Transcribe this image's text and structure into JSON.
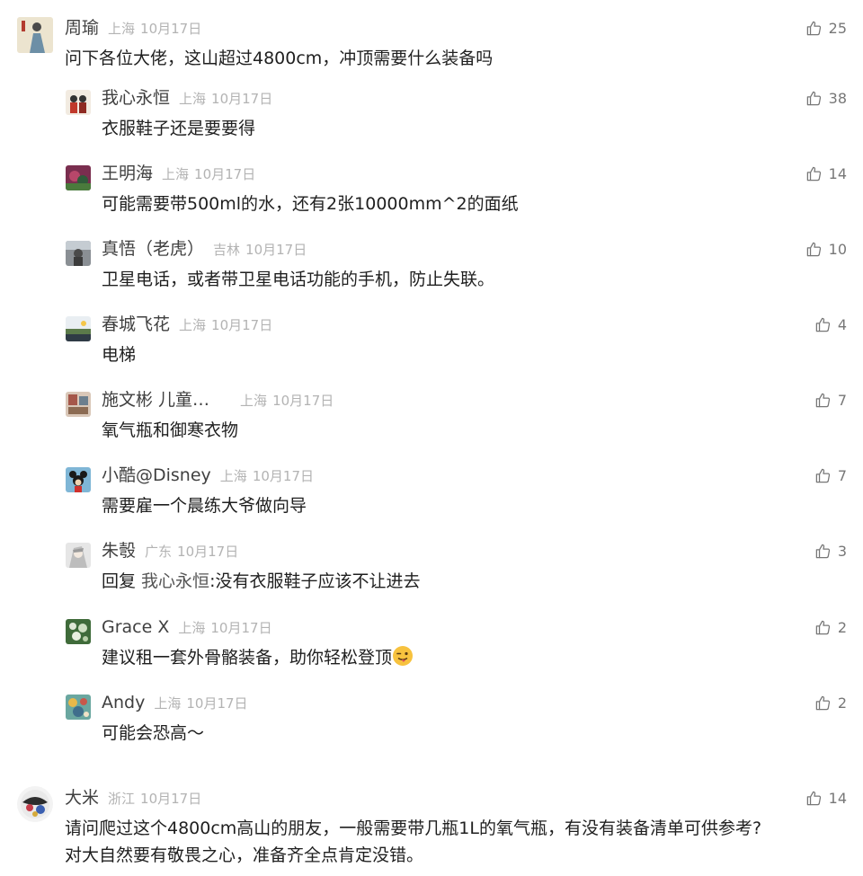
{
  "comments": [
    {
      "name": "周瑜",
      "location": "上海",
      "date": "10月17日",
      "likes": "25",
      "text": "问下各位大佬，这山超过4800cm，冲顶需要什么装备吗"
    },
    {
      "name": "我心永恒",
      "location": "上海",
      "date": "10月17日",
      "likes": "38",
      "text": "衣服鞋子还是要要得"
    },
    {
      "name": "王明海",
      "location": "上海",
      "date": "10月17日",
      "likes": "14",
      "text": "可能需要带500ml的水，还有2张10000mm^2的面纸"
    },
    {
      "name": "真悟（老虎）",
      "location": "吉林",
      "date": "10月17日",
      "likes": "10",
      "text": "卫星电话，或者带卫星电话功能的手机，防止失联。"
    },
    {
      "name": "春城飞花",
      "location": "上海",
      "date": "10月17日",
      "likes": "4",
      "text": "电梯"
    },
    {
      "name": "施文彬 儿童…",
      "location": "上海",
      "date": "10月17日",
      "likes": "7",
      "text": "氧气瓶和御寒衣物"
    },
    {
      "name": "小酷@Disney",
      "location": "上海",
      "date": "10月17日",
      "likes": "7",
      "text": "需要雇一个晨练大爷做向导"
    },
    {
      "name": "朱彀",
      "location": "广东",
      "date": "10月17日",
      "likes": "3",
      "reply_prefix": "回复 ",
      "reply_to": "我心永恒",
      "text": ":没有衣服鞋子应该不让进去"
    },
    {
      "name": "Grace X",
      "location": "上海",
      "date": "10月17日",
      "likes": "2",
      "text": "建议租一套外骨骼装备，助你轻松登顶"
    },
    {
      "name": "Andy",
      "location": "上海",
      "date": "10月17日",
      "likes": "2",
      "text": "可能会恐高～"
    },
    {
      "name": "大米",
      "location": "浙江",
      "date": "10月17日",
      "likes": "14",
      "text": "请问爬过这个4800cm高山的朋友，一般需要带几瓶1L的氧气瓶，有没有装备清单可供参考?",
      "text2": "对大自然要有敬畏之心，准备齐全点肯定没错。"
    }
  ],
  "icons": {
    "like": "thumbs-up-icon",
    "emoji": "winking-tongue-emoji"
  },
  "colors": {
    "name": "#404040",
    "meta": "#b3b3b3",
    "text": "#1f1f1f",
    "like": "#777777"
  }
}
